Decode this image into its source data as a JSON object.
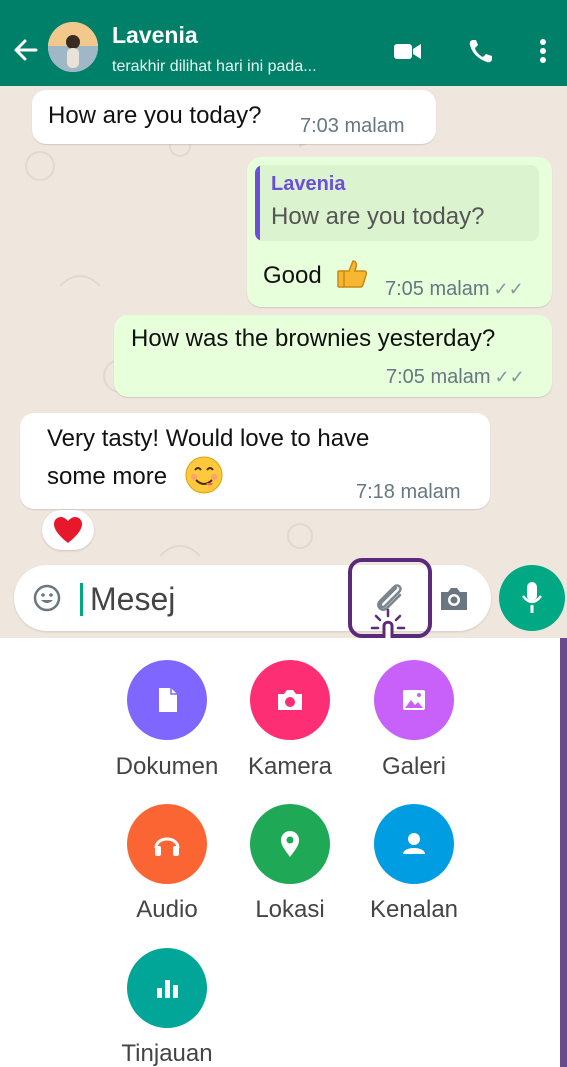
{
  "header": {
    "contact_name": "Lavenia",
    "last_seen": "terakhir dilihat hari ini pada...",
    "color": "#008069"
  },
  "messages": [
    {
      "direction": "in",
      "text": "How are you today?",
      "time": "7:03 malam"
    },
    {
      "direction": "out",
      "quote": {
        "author": "Lavenia",
        "text": "How are you today?"
      },
      "text": "Good",
      "emoji": "thumbs-up",
      "time": "7:05 malam",
      "status": "read-double-tick"
    },
    {
      "direction": "out",
      "text": "How was the brownies yesterday?",
      "time": "7:05 malam",
      "status": "read-double-tick"
    },
    {
      "direction": "in",
      "text_line1": "Very tasty! Would love to have",
      "text_line2": "some more",
      "emoji": "yum-face",
      "time": "7:18 malam",
      "reaction": "red-heart"
    }
  ],
  "input": {
    "placeholder": "Mesej",
    "accent": "#00a884"
  },
  "attach_menu": [
    {
      "label": "Dokumen",
      "icon": "document-icon",
      "color": "#7f66ff"
    },
    {
      "label": "Kamera",
      "icon": "camera-icon",
      "color": "#fe2e74"
    },
    {
      "label": "Galeri",
      "icon": "gallery-icon",
      "color": "#c861fa"
    },
    {
      "label": "Audio",
      "icon": "headphones-icon",
      "color": "#fa6533"
    },
    {
      "label": "Lokasi",
      "icon": "location-pin-icon",
      "color": "#1fa855"
    },
    {
      "label": "Kenalan",
      "icon": "contact-icon",
      "color": "#009de2"
    },
    {
      "label": "Tinjauan",
      "icon": "poll-icon",
      "color": "#02a698"
    }
  ]
}
